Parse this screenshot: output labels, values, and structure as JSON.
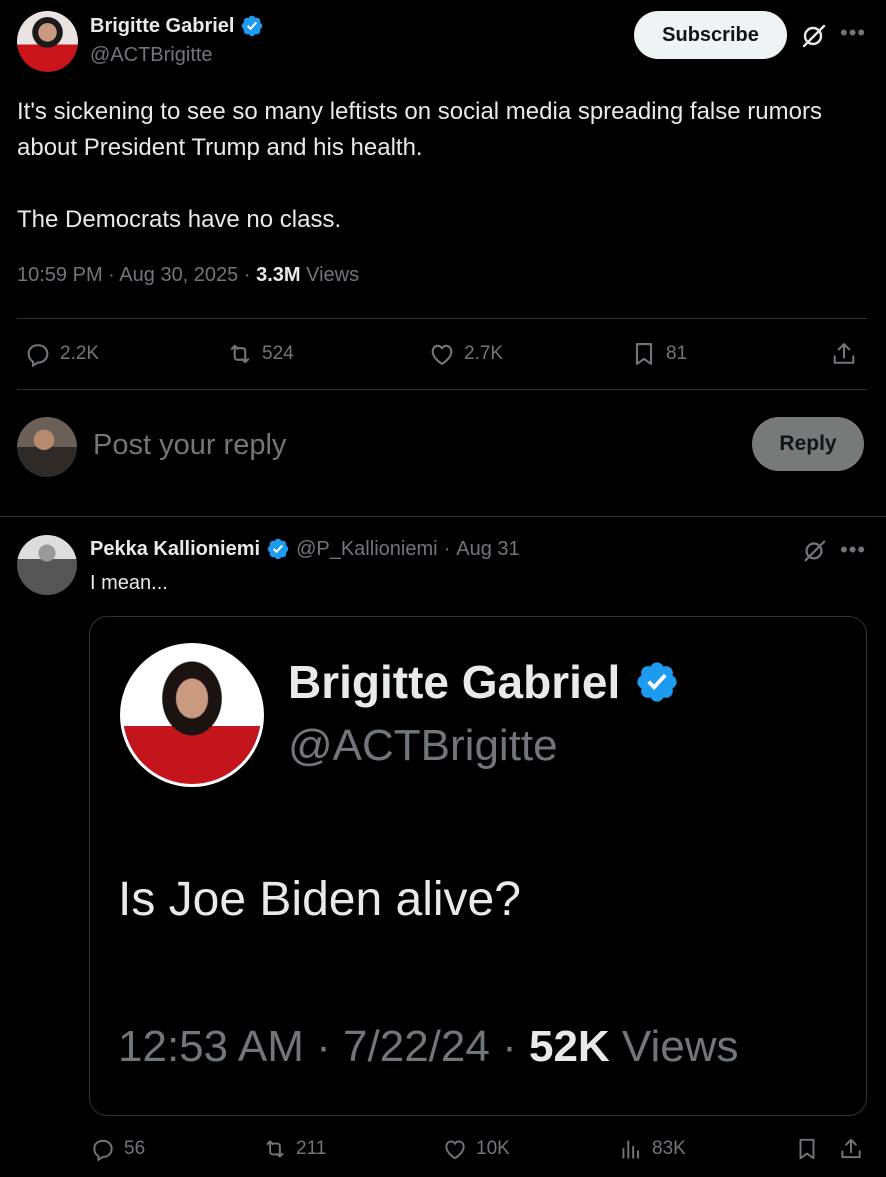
{
  "main_tweet": {
    "author_name": "Brigitte Gabriel",
    "author_handle": "@ACTBrigitte",
    "subscribe_label": "Subscribe",
    "text": "It's sickening to see so many leftists on social media spreading false rumors about President Trump and his health.\n\nThe Democrats have no class.",
    "time": "10:59 PM",
    "date": "Aug 30, 2025",
    "views_count": "3.3M",
    "views_label": "Views",
    "sep": "·",
    "stats": {
      "replies": "2.2K",
      "reposts": "524",
      "likes": "2.7K",
      "bookmarks": "81"
    }
  },
  "reply_box": {
    "placeholder": "Post your reply",
    "button_label": "Reply"
  },
  "reply_tweet": {
    "author_name": "Pekka Kallioniemi",
    "author_handle": "@P_Kallioniemi",
    "date": "Aug 31",
    "sep": "·",
    "text": "I mean...",
    "stats": {
      "replies": "56",
      "reposts": "211",
      "likes": "10K",
      "views": "83K"
    },
    "embedded_image": {
      "name": "Brigitte Gabriel",
      "handle": "@ACTBrigitte",
      "text": "Is Joe Biden alive?",
      "time": "12:53 AM",
      "date": "7/22/24",
      "views_count": "52K",
      "views_label": "Views",
      "sep": "·"
    }
  },
  "colors": {
    "background": "#000000",
    "text": "#e7e9ea",
    "muted": "#71767b",
    "verified": "#1d9bf0",
    "divider": "#2f3336"
  },
  "icons": [
    "verified-badge-icon",
    "grok-icon",
    "more-icon",
    "reply-icon",
    "repost-icon",
    "like-icon",
    "bookmark-icon",
    "share-icon",
    "views-icon"
  ]
}
